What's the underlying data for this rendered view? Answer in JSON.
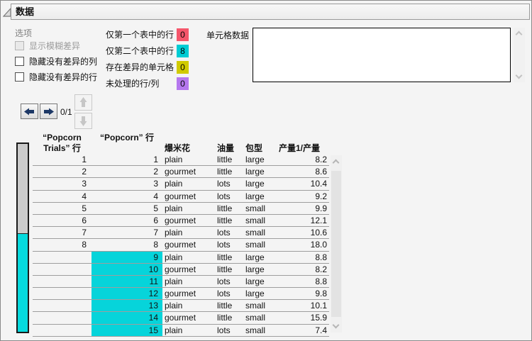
{
  "panel": {
    "title": "数据"
  },
  "options": {
    "label": "选项",
    "checkboxes": [
      {
        "label": "显示模糊差异",
        "checked": false,
        "disabled": true
      },
      {
        "label": "隐藏没有差异的列",
        "checked": false,
        "disabled": false
      },
      {
        "label": "隐藏没有差异的行",
        "checked": false,
        "disabled": false
      }
    ]
  },
  "legend": {
    "items": [
      {
        "label": "仅第一个表中的行",
        "count": "0",
        "color": "#f5566b"
      },
      {
        "label": "仅第二个表中的行",
        "count": "8",
        "color": "#00ccd4"
      },
      {
        "label": "存在差异的单元格",
        "count": "0",
        "color": "#d0ca00"
      },
      {
        "label": "未处理的行/列",
        "count": "0",
        "color": "#b577ee"
      }
    ]
  },
  "cell_data": {
    "label": "单元格数据",
    "value": ""
  },
  "navigation": {
    "counter": "0/1"
  },
  "colors": {
    "only_second_highlight": "#06d4da",
    "map_match_grey": "#cbcbcb",
    "nav_arrow_navy": "#1d3866"
  },
  "table": {
    "header": {
      "col1_line1": "“Popcorn",
      "col1_line2": "Trials” 行",
      "col2": "“Popcorn” 行",
      "col3": "爆米花",
      "col4": "油量",
      "col5": "包型",
      "col6": "产量1/产量"
    },
    "rows": [
      {
        "cells": [
          "1",
          "1",
          "plain",
          "little",
          "large",
          "8.2"
        ],
        "only_in_second": false
      },
      {
        "cells": [
          "2",
          "2",
          "gourmet",
          "little",
          "large",
          "8.6"
        ],
        "only_in_second": false
      },
      {
        "cells": [
          "3",
          "3",
          "plain",
          "lots",
          "large",
          "10.4"
        ],
        "only_in_second": false
      },
      {
        "cells": [
          "4",
          "4",
          "gourmet",
          "lots",
          "large",
          "9.2"
        ],
        "only_in_second": false
      },
      {
        "cells": [
          "5",
          "5",
          "plain",
          "little",
          "small",
          "9.9"
        ],
        "only_in_second": false
      },
      {
        "cells": [
          "6",
          "6",
          "gourmet",
          "little",
          "small",
          "12.1"
        ],
        "only_in_second": false
      },
      {
        "cells": [
          "7",
          "7",
          "plain",
          "lots",
          "small",
          "10.6"
        ],
        "only_in_second": false
      },
      {
        "cells": [
          "8",
          "8",
          "gourmet",
          "lots",
          "small",
          "18.0"
        ],
        "only_in_second": false
      },
      {
        "cells": [
          "",
          "9",
          "plain",
          "little",
          "large",
          "8.8"
        ],
        "only_in_second": true
      },
      {
        "cells": [
          "",
          "10",
          "gourmet",
          "little",
          "large",
          "8.2"
        ],
        "only_in_second": true
      },
      {
        "cells": [
          "",
          "11",
          "plain",
          "lots",
          "large",
          "8.8"
        ],
        "only_in_second": true
      },
      {
        "cells": [
          "",
          "12",
          "gourmet",
          "lots",
          "large",
          "9.8"
        ],
        "only_in_second": true
      },
      {
        "cells": [
          "",
          "13",
          "plain",
          "little",
          "small",
          "10.1"
        ],
        "only_in_second": true
      },
      {
        "cells": [
          "",
          "14",
          "gourmet",
          "little",
          "small",
          "15.9"
        ],
        "only_in_second": true
      },
      {
        "cells": [
          "",
          "15",
          "plain",
          "lots",
          "small",
          "7.4"
        ],
        "only_in_second": true
      }
    ]
  }
}
